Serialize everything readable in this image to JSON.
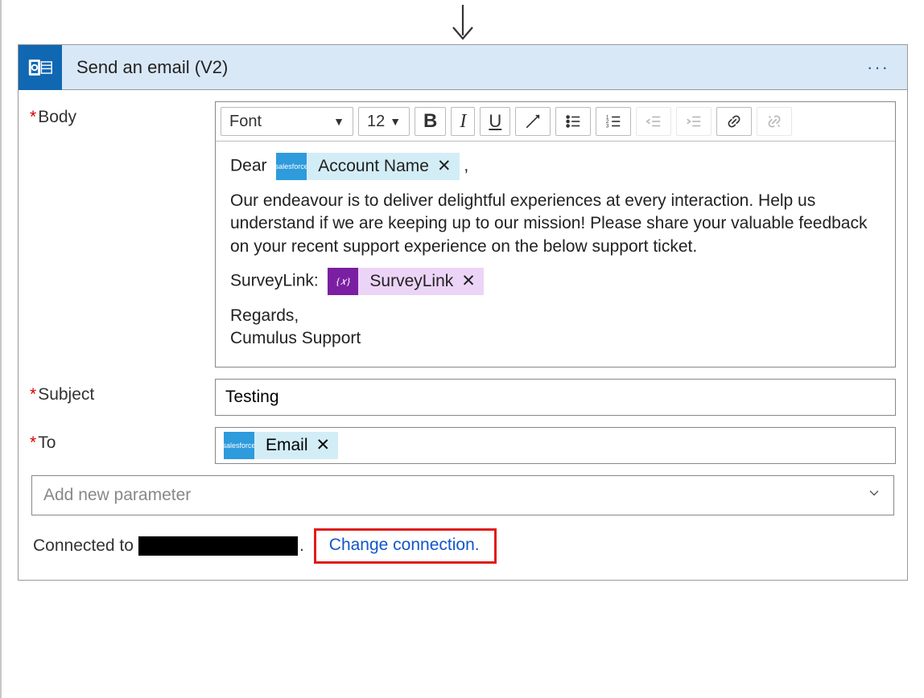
{
  "card": {
    "title": "Send an email (V2)",
    "menu_label": "···"
  },
  "labels": {
    "body": "Body",
    "subject": "Subject",
    "to": "To"
  },
  "toolbar": {
    "font_label": "Font",
    "size_label": "12"
  },
  "body_content": {
    "greeting_prefix": "Dear",
    "greeting_suffix": ",",
    "token_account": "Account Name",
    "paragraph": "Our endeavour is to deliver delightful experiences at every interaction. Help us understand if we are keeping up to our mission! Please share your valuable feedback on your recent support experience on the below support ticket.",
    "survey_prefix": "SurveyLink:",
    "token_surveylink": "SurveyLink",
    "var_icon": "{𝑥}",
    "regards": "Regards,",
    "signature": "Cumulus Support"
  },
  "subject_value": "Testing",
  "to_token": "Email",
  "param_placeholder": "Add new parameter",
  "footer": {
    "connected_prefix": "Connected to",
    "dot": ".",
    "change_link": "Change connection."
  },
  "sf_badge": "salesforce"
}
